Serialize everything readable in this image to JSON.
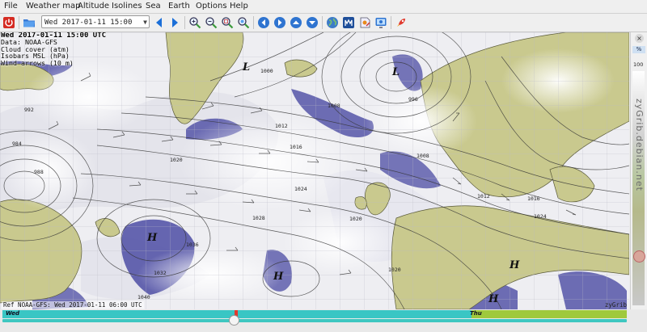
{
  "menubar": {
    "items": [
      {
        "label": "File"
      },
      {
        "label": "Weather map"
      },
      {
        "label": "Altitude"
      },
      {
        "label": "Isolines"
      },
      {
        "label": "Sea"
      },
      {
        "label": "Earth"
      },
      {
        "label": "Options"
      },
      {
        "label": "Help"
      }
    ]
  },
  "toolbar": {
    "date_value": "Wed 2017-01-11 15:00 UTC"
  },
  "map": {
    "info_title": "Wed 2017-01-11 15:00 UTC",
    "info_lines": [
      "Data: NOAA-GFS",
      "Cloud cover (atm)",
      "Isobars MSL (hPa)",
      "Wind arrows (10 m)"
    ],
    "ref_text": "Ref NOAA-GFS: Wed 2017-01-11 06:00 UTC",
    "brand": "zyGrib",
    "pressure_labels": [
      "1000",
      "1008",
      "1012",
      "1016",
      "1020",
      "1024",
      "1028",
      "1032",
      "1036",
      "1040",
      "992",
      "996",
      "984",
      "988"
    ],
    "highs": [
      "H",
      "H",
      "H",
      "H"
    ],
    "lows": [
      "L",
      "L"
    ]
  },
  "sidebar": {
    "unit": "%",
    "max": "100",
    "vertical_text": "zyGrib.debian.net"
  },
  "timeline": {
    "day1": "Wed",
    "day2": "Thu",
    "position": 0.37
  },
  "colors": {
    "land": "#c9c98e",
    "sea_low_cloud": "#5555a8",
    "cloud": "#ffffff",
    "timeline_track": "#3ec7c0",
    "timeline_day1": "#39c6c4",
    "timeline_day2": "#9fc93c"
  }
}
